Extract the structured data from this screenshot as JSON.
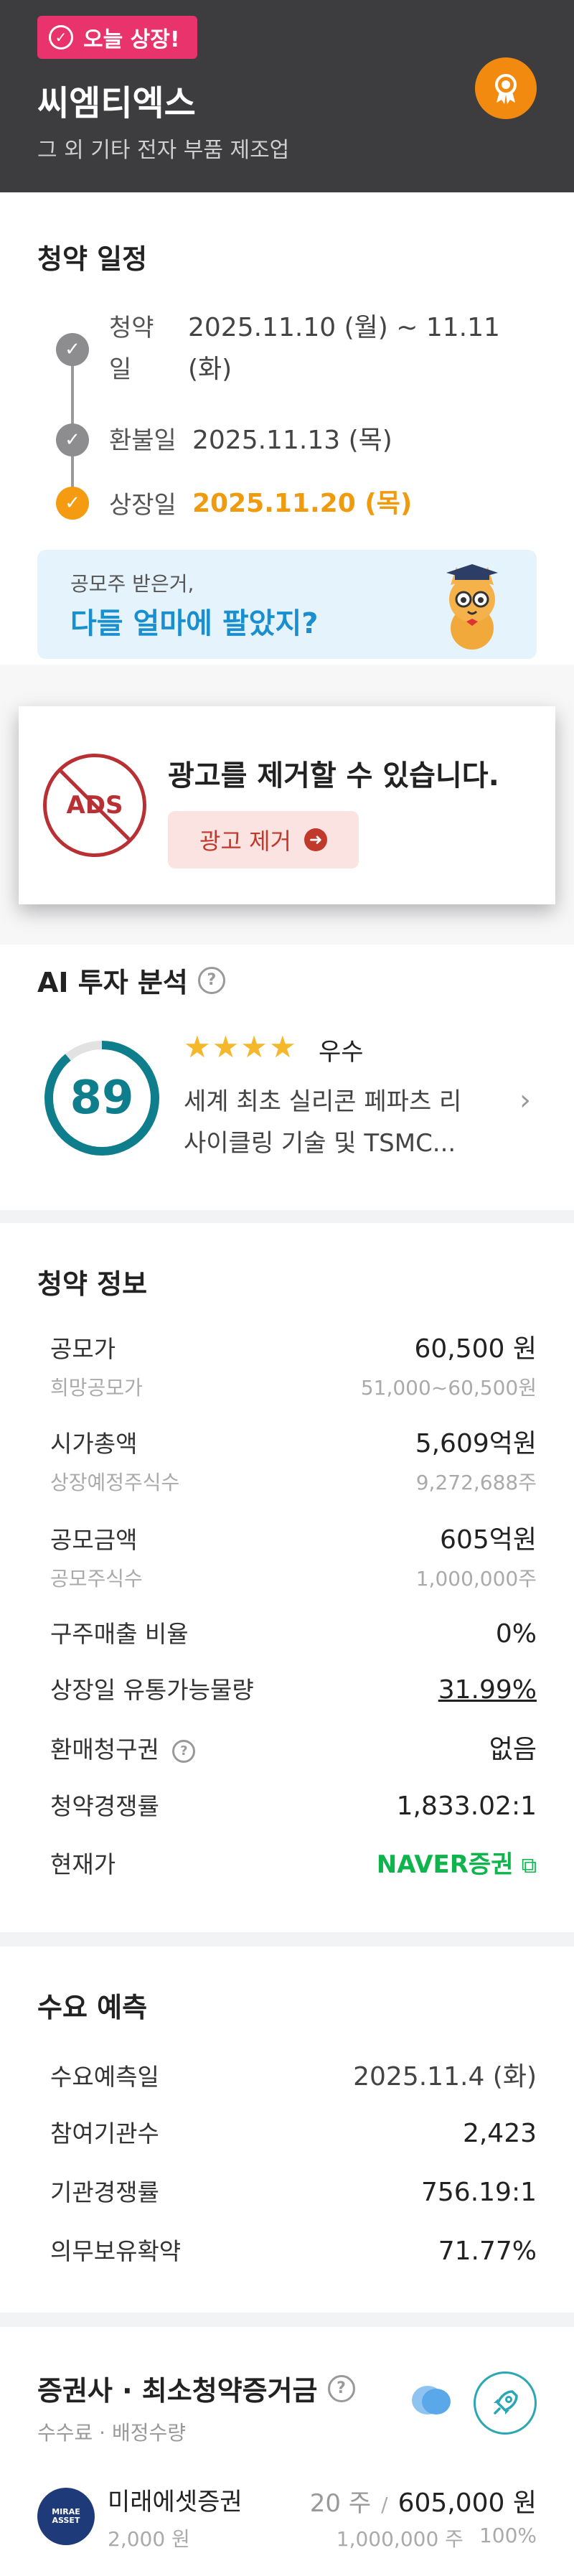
{
  "header": {
    "badge": "오늘 상장!",
    "company": "씨엠티엑스",
    "industry": "그 외 기타 전자 부품 제조업"
  },
  "schedule": {
    "title": "청약 일정",
    "items": [
      {
        "label_line1": "청약",
        "label_line2": "일",
        "value_line1": "2025.11.10 (월) ~ 11.11",
        "value_line2": "(화)",
        "status": "done"
      },
      {
        "label": "환불일",
        "value": "2025.11.13 (목)",
        "status": "done"
      },
      {
        "label": "상장일",
        "value": "2025.11.20 (목)",
        "status": "today"
      }
    ],
    "banner_small": "공모주 받은거,",
    "banner_large": "다들 얼마에 팔았지?"
  },
  "ad": {
    "icon_text": "ADS",
    "title": "광고를 제거할 수 있습니다.",
    "button": "광고 제거"
  },
  "ai": {
    "title": "AI 투자 분석",
    "score": "89",
    "score_value": 89,
    "stars": "★★★★",
    "grade": "우수",
    "summary_line1": "세계 최초 실리콘 페파츠 리",
    "summary_line2": "사이클링 기술 및 TSMC..."
  },
  "info": {
    "title": "청약 정보",
    "rows": [
      {
        "k": "공모가",
        "v": "60,500 원",
        "sub_k": "희망공모가",
        "sub_v": "51,000~60,500원"
      },
      {
        "k": "시가총액",
        "v": "5,609억원",
        "sub_k": "상장예정주식수",
        "sub_v": "9,272,688주"
      },
      {
        "k": "공모금액",
        "v": "605억원",
        "sub_k": "공모주식수",
        "sub_v": "1,000,000주"
      },
      {
        "k": "구주매출 비율",
        "v": "0%"
      },
      {
        "k": "상장일 유통가능물량",
        "v": "31.99%"
      },
      {
        "k": "환매청구권",
        "v": "없음"
      },
      {
        "k": "청약경쟁률",
        "v": "1,833.02:1"
      },
      {
        "k": "현재가",
        "v": "NAVER증권"
      }
    ]
  },
  "demand": {
    "title": "수요 예측",
    "rows": [
      {
        "k": "수요예측일",
        "v": "2025.11.4 (화)"
      },
      {
        "k": "참여기관수",
        "v": "2,423"
      },
      {
        "k": "기관경쟁률",
        "v": "756.19:1"
      },
      {
        "k": "의무보유확약",
        "v": "71.77%"
      }
    ]
  },
  "brokers": {
    "title": "증권사 · 최소청약증거금",
    "subtitle": "수수료 · 배정수량",
    "items": [
      {
        "logo": "MIRAE ASSET",
        "name": "미래에셋증권",
        "fee": "2,000 원",
        "shares": "20 주",
        "sep": "/",
        "amount": "605,000 원",
        "alloc": "1,000,000 주",
        "pct": "100%"
      }
    ]
  }
}
